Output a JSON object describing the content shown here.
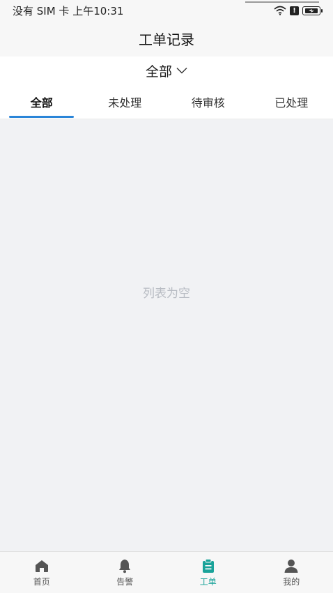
{
  "status_bar": {
    "left_text": "没有 SIM 卡 上午10:31",
    "icons": [
      "wifi-icon",
      "alert-icon",
      "battery-icon"
    ]
  },
  "header": {
    "title": "工单记录"
  },
  "filter": {
    "selected": "全部",
    "icon": "chevron-down-icon"
  },
  "tabs": [
    {
      "label": "全部",
      "active": true
    },
    {
      "label": "未处理",
      "active": false
    },
    {
      "label": "待审核",
      "active": false
    },
    {
      "label": "已处理",
      "active": false
    }
  ],
  "main": {
    "empty_text": "列表为空"
  },
  "bottom_nav": {
    "accent_color": "#1aa39a",
    "items": [
      {
        "label": "首页",
        "icon": "home-icon",
        "active": false
      },
      {
        "label": "告警",
        "icon": "bell-icon",
        "active": false
      },
      {
        "label": "工单",
        "icon": "clipboard-icon",
        "active": true
      },
      {
        "label": "我的",
        "icon": "person-icon",
        "active": false
      }
    ]
  },
  "colors": {
    "tab_indicator": "#2a85d8",
    "empty_text": "#b8bcc3"
  }
}
